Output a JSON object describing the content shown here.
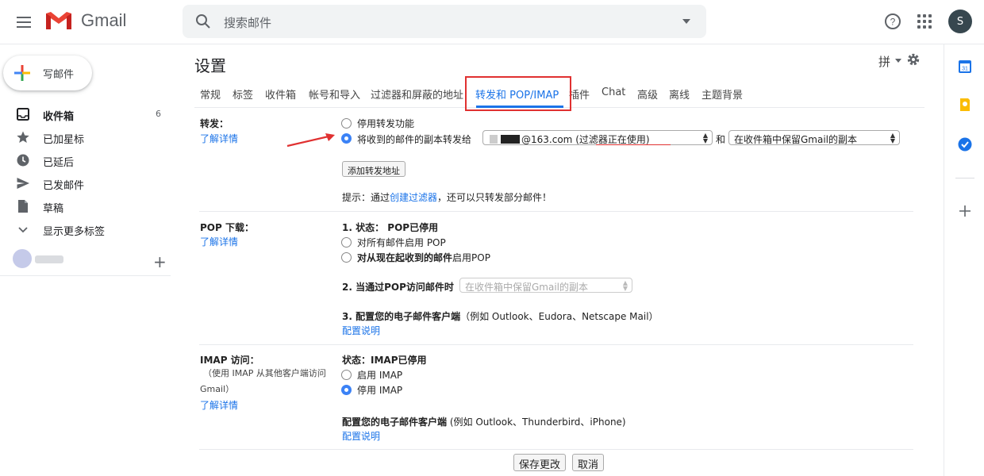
{
  "app": {
    "name": "Gmail",
    "avatar_letter": "S"
  },
  "header": {
    "search_placeholder": "搜索邮件",
    "icons": [
      "menu-icon",
      "gmail-logo-icon",
      "search-icon",
      "help-icon",
      "apps-icon"
    ]
  },
  "sidebar": {
    "compose_label": "写邮件",
    "items": [
      {
        "label": "收件箱",
        "count": "6",
        "icon": "inbox-icon",
        "bold": true
      },
      {
        "label": "已加星标",
        "count": "",
        "icon": "star-icon"
      },
      {
        "label": "已延后",
        "count": "",
        "icon": "clock-icon"
      },
      {
        "label": "已发邮件",
        "count": "",
        "icon": "send-icon"
      },
      {
        "label": "草稿",
        "count": "",
        "icon": "draft-icon"
      },
      {
        "label": "显示更多标签",
        "count": "",
        "icon": "chevron-down-icon"
      }
    ]
  },
  "settings": {
    "title": "设置",
    "ime_label": "拼",
    "tabs": [
      {
        "label": "常规"
      },
      {
        "label": "标签"
      },
      {
        "label": "收件箱"
      },
      {
        "label": "帐号和导入"
      },
      {
        "label": "过滤器和屏蔽的地址"
      },
      {
        "label": "转发和 POP/IMAP",
        "active": true
      },
      {
        "label": "插件"
      },
      {
        "label": "Chat"
      },
      {
        "label": "高级"
      },
      {
        "label": "离线"
      },
      {
        "label": "主题背景"
      }
    ],
    "forwarding": {
      "label": "转发：",
      "learn_more": "了解详情",
      "option_disable": "停用转发功能",
      "option_forward": "将收到的邮件的副本转发给",
      "address_suffix": "@163.com",
      "filter_note": "(过滤器正在使用)",
      "and_label": "和",
      "keep_copy_select": "在收件箱中保留Gmail的副本",
      "add_address_button": "添加转发地址",
      "tip_prefix": "提示：通过",
      "tip_link": "创建过滤器",
      "tip_suffix": "，还可以只转发部分邮件！"
    },
    "pop": {
      "label": "POP 下载：",
      "learn_more": "了解详情",
      "status_prefix": "1. 状态：",
      "status_value": "POP已停用",
      "option_all": "对所有邮件启用 POP",
      "option_new_bold": "对从现在起收到的邮件",
      "option_new_rest": "启用POP",
      "when_access": "2. 当通过POP访问邮件时",
      "when_select": "在收件箱中保留Gmail的副本",
      "configure_bold": "3. 配置您的电子邮件客户端",
      "configure_rest": "（例如 Outlook、Eudora、Netscape Mail）",
      "config_link": "配置说明"
    },
    "imap": {
      "label": "IMAP 访问：",
      "sub_line1": "（使用 IMAP 从其他客户端访问",
      "sub_line2": "Gmail）",
      "learn_more": "了解详情",
      "status_prefix": "状态：",
      "status_value": "IMAP已停用",
      "option_enable": "启用 IMAP",
      "option_disable": "停用 IMAP",
      "configure_bold": "配置您的电子邮件客户端",
      "configure_rest": " (例如 Outlook、Thunderbird、iPhone)",
      "config_link": "配置说明"
    },
    "save_button": "保存更改",
    "cancel_button": "取消"
  },
  "colors": {
    "accent": "#1a73e8",
    "annotation_red": "#e03131",
    "radio_checked": "#3b82f6"
  }
}
